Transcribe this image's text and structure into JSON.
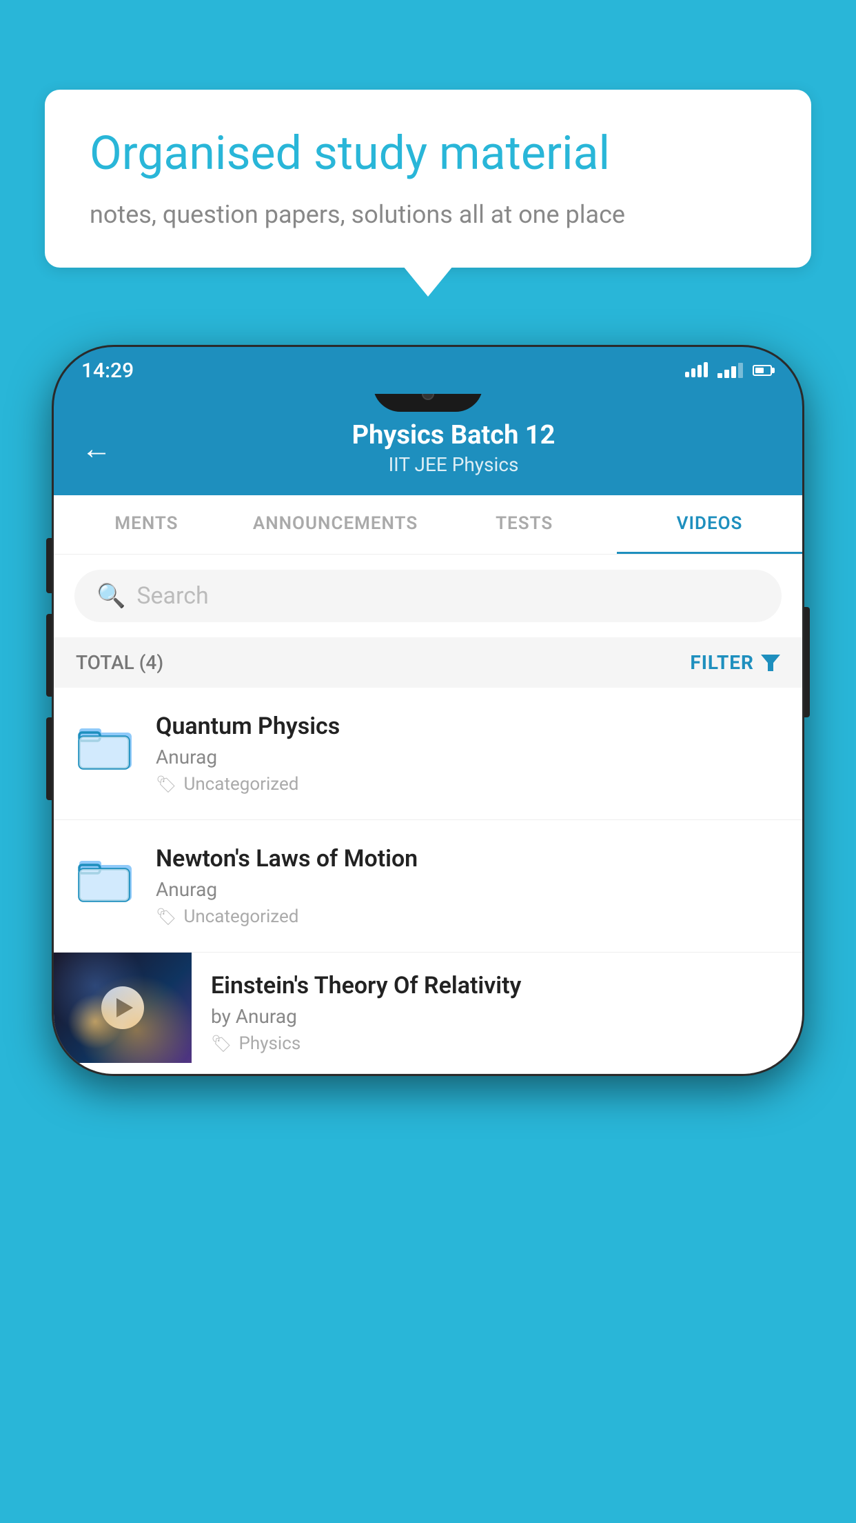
{
  "background_color": "#29b6d8",
  "speech_bubble": {
    "title": "Organised study material",
    "subtitle": "notes, question papers, solutions all at one place"
  },
  "phone": {
    "status_bar": {
      "time": "14:29",
      "wifi": true,
      "signal": true,
      "battery": true
    },
    "header": {
      "title": "Physics Batch 12",
      "subtitle": "IIT JEE   Physics",
      "back_label": "←"
    },
    "tabs": [
      {
        "label": "MENTS",
        "active": false
      },
      {
        "label": "ANNOUNCEMENTS",
        "active": false
      },
      {
        "label": "TESTS",
        "active": false
      },
      {
        "label": "VIDEOS",
        "active": true
      }
    ],
    "search": {
      "placeholder": "Search"
    },
    "filter_bar": {
      "total_label": "TOTAL (4)",
      "filter_label": "FILTER"
    },
    "video_list": [
      {
        "title": "Quantum Physics",
        "author": "Anurag",
        "tag": "Uncategorized",
        "type": "folder",
        "has_thumbnail": false
      },
      {
        "title": "Newton's Laws of Motion",
        "author": "Anurag",
        "tag": "Uncategorized",
        "type": "folder",
        "has_thumbnail": false
      },
      {
        "title": "Einstein's Theory Of Relativity",
        "author": "by Anurag",
        "tag": "Physics",
        "type": "video",
        "has_thumbnail": true
      }
    ]
  }
}
